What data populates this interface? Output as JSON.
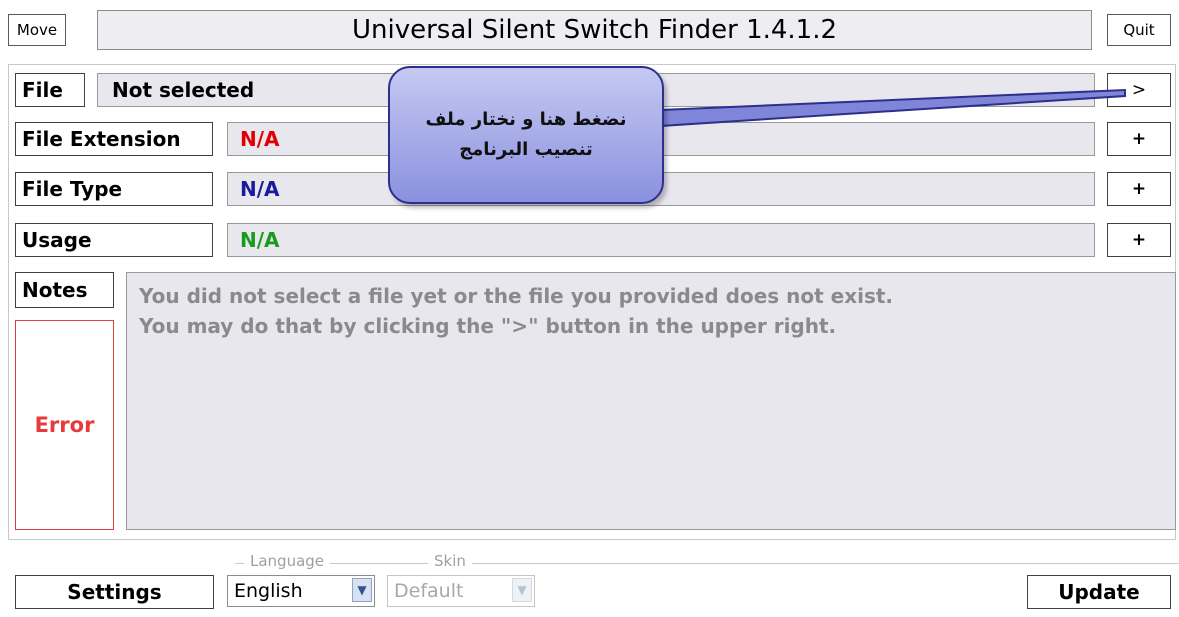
{
  "header": {
    "move_label": "Move",
    "title": "Universal Silent Switch Finder 1.4.1.2",
    "quit_label": "Quit"
  },
  "fields": {
    "file": {
      "label": "File",
      "value": "Not selected",
      "button": ">"
    },
    "extension": {
      "label": "File Extension",
      "value": "N/A",
      "button": "+",
      "value_color": "#e00000"
    },
    "type": {
      "label": "File Type",
      "value": "N/A",
      "button": "+",
      "value_color": "#1a1a9a"
    },
    "usage": {
      "label": "Usage",
      "value": "N/A",
      "button": "+",
      "value_color": "#1a9a1a"
    }
  },
  "notes": {
    "label": "Notes",
    "line1": "You did not select a file yet or the file you provided does not exist.",
    "line2": "You may do that by clicking the \">\" button in the upper right."
  },
  "status": {
    "label": "Error"
  },
  "callout": {
    "line1": "نضغط هنا و نختار ملف",
    "line2": "تنصيب البرنامج"
  },
  "footer": {
    "settings_label": "Settings",
    "language_group": "Language",
    "skin_group": "Skin",
    "language_value": "English",
    "skin_value": "Default",
    "update_label": "Update"
  }
}
